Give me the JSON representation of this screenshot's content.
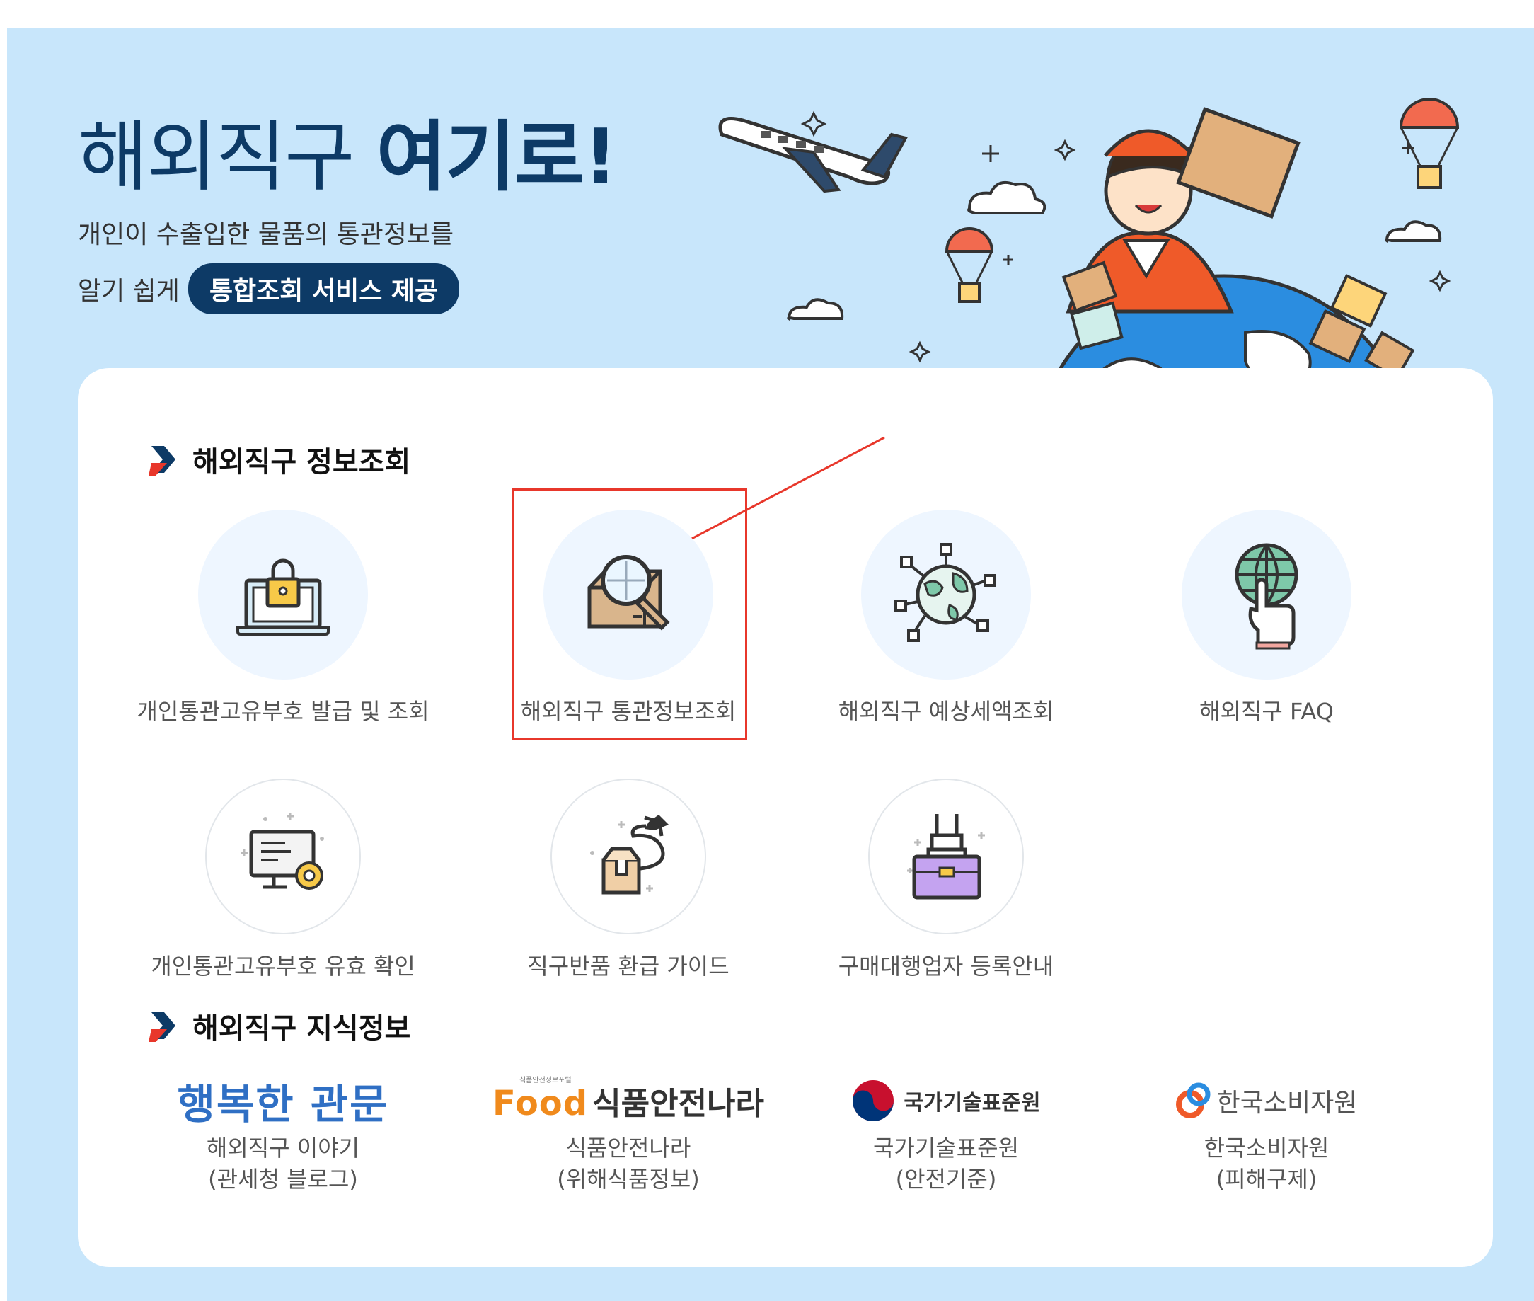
{
  "hero": {
    "title_light": "해외직구",
    "title_bold": "여기로!",
    "line1": "개인이 수출입한 물품의 통관정보를",
    "line2_prefix": "알기 쉽게",
    "line2_pill": "통합조회 서비스 제공"
  },
  "sections": {
    "info_lookup": "해외직구 정보조회",
    "knowledge": "해외직구 지식정보"
  },
  "services": [
    {
      "label": "개인통관고유부호 발급 및 조회",
      "icon": "laptop-lock-icon"
    },
    {
      "label": "해외직구 통관정보조회",
      "icon": "box-magnifier-icon"
    },
    {
      "label": "해외직구 예상세액조회",
      "icon": "globe-network-icon"
    },
    {
      "label": "해외직구 FAQ",
      "icon": "globe-hand-icon"
    },
    {
      "label": "개인통관고유부호 유효 확인",
      "icon": "monitor-gear-icon"
    },
    {
      "label": "직구반품 환급 가이드",
      "icon": "box-airplane-icon"
    },
    {
      "label": "구매대행업자 등록안내",
      "icon": "bag-hand-icon"
    }
  ],
  "logos": [
    {
      "mark": "행복한 관문",
      "line1": "해외직구 이야기",
      "line2": "(관세청 블로그)"
    },
    {
      "mark_small": "식품안전정보포털",
      "mark_food": "Food",
      "mark": "식품안전나라",
      "line1": "식품안전나라",
      "line2": "(위해식품정보)"
    },
    {
      "mark": "국가기술표준원",
      "line1": "국가기술표준원",
      "line2": "(안전기준)"
    },
    {
      "mark": "한국소비자원",
      "line1": "한국소비자원",
      "line2": "(피해구제)"
    }
  ],
  "colors": {
    "background": "#c8e6fb",
    "navy": "#0d3a66",
    "highlight_red": "#e8372b",
    "icon_circle": "#eef6ff"
  }
}
